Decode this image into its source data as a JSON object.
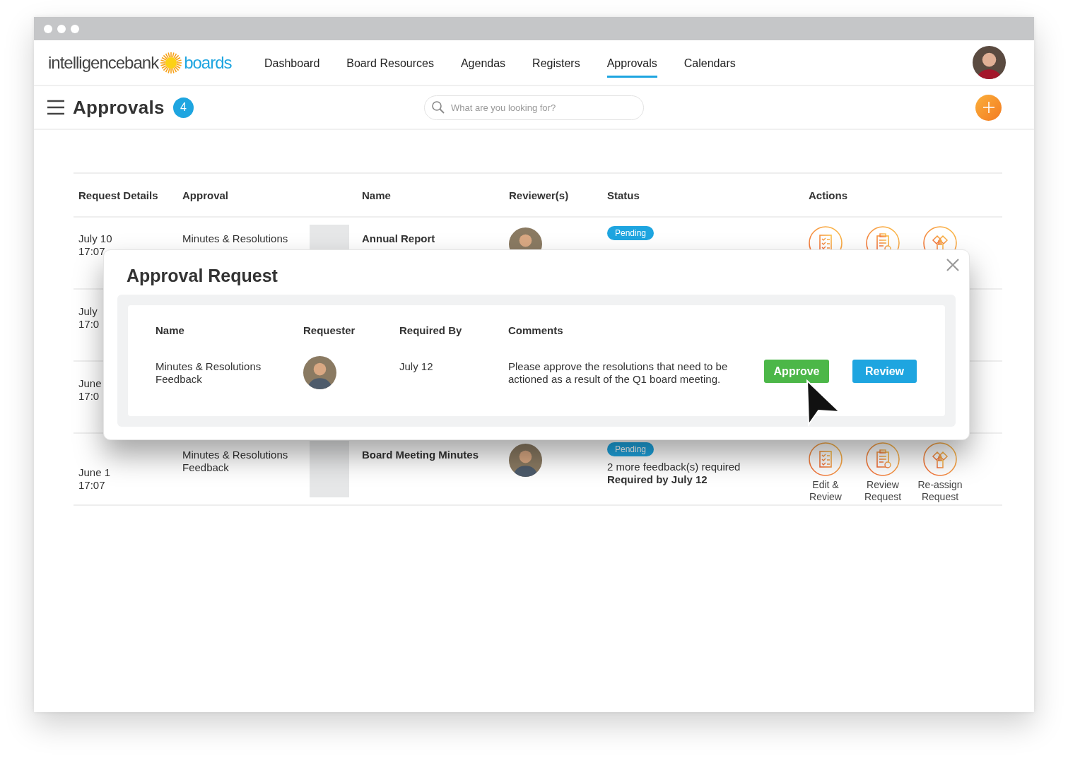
{
  "logo": {
    "name": "intelligencebank",
    "product": "boards"
  },
  "nav": [
    {
      "label": "Dashboard",
      "selected": false
    },
    {
      "label": "Board Resources",
      "selected": false
    },
    {
      "label": "Agendas",
      "selected": false
    },
    {
      "label": "Registers",
      "selected": false
    },
    {
      "label": "Approvals",
      "selected": true
    },
    {
      "label": "Calendars",
      "selected": false
    }
  ],
  "page": {
    "title": "Approvals",
    "count": "4"
  },
  "search": {
    "placeholder": "What are you looking for?"
  },
  "table": {
    "columns": [
      "Request Details",
      "Approval",
      "",
      "Name",
      "Reviewer(s)",
      "Status",
      "Actions"
    ],
    "rows": [
      {
        "date": "July 10",
        "time": "17:07",
        "approval": "Minutes & Resolutions",
        "thumbnail": true,
        "name": "Annual Report",
        "reviewers": [
          {
            "kind": "photo"
          }
        ],
        "status": {
          "badge": "Pending"
        },
        "actions": [
          {
            "kind": "edit"
          },
          {
            "kind": "review"
          },
          {
            "kind": "reassign"
          }
        ]
      },
      {
        "date": "July",
        "time": "17:0"
      },
      {
        "date": "June",
        "time": "17:0"
      },
      {
        "date": "June 1",
        "time": "17:07",
        "approval": "Minutes & Resolutions Feedback",
        "thumbnail": true,
        "name": "Board Meeting Minutes",
        "reviewers": [
          {
            "kind": "photo"
          }
        ],
        "status": {
          "badge": "Pending",
          "note": "2 more feedback(s) required",
          "due": "Required by July 12"
        },
        "actions": [
          {
            "kind": "edit",
            "label": "Edit & Review"
          },
          {
            "kind": "review",
            "label": "Review Request"
          },
          {
            "kind": "reassign",
            "label": "Re-assign Request"
          }
        ]
      }
    ]
  },
  "modal": {
    "title": "Approval Request",
    "columns": [
      "Name",
      "Requester",
      "Required By",
      "Comments"
    ],
    "item": {
      "name": "Minutes & Resolutions Feedback",
      "requester": {
        "kind": "photo"
      },
      "required_by": "July 12",
      "comments": "Please approve the resolutions that need to be actioned as a result of the Q1 board meeting."
    },
    "buttons": [
      {
        "label": "Approve",
        "kind": "primary"
      },
      {
        "label": "Review",
        "kind": "secondary"
      }
    ]
  }
}
